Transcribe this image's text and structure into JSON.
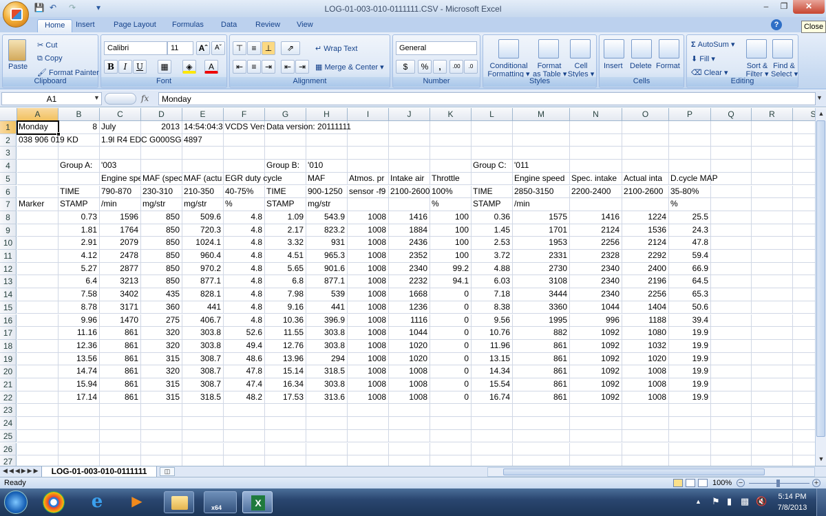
{
  "window": {
    "title": "LOG-01-003-010-0111111.CSV - Microsoft Excel",
    "close_tooltip": "Close"
  },
  "tabs": [
    "Home",
    "Insert",
    "Page Layout",
    "Formulas",
    "Data",
    "Review",
    "View"
  ],
  "ribbon": {
    "clipboard": {
      "label": "Clipboard",
      "paste": "Paste",
      "cut": "Cut",
      "copy": "Copy",
      "format_painter": "Format Painter"
    },
    "font": {
      "label": "Font",
      "name": "Calibri",
      "size": "11"
    },
    "alignment": {
      "label": "Alignment",
      "wrap": "Wrap Text",
      "merge": "Merge & Center"
    },
    "number": {
      "label": "Number",
      "format": "General"
    },
    "styles": {
      "label": "Styles",
      "cond1": "Conditional",
      "cond2": "Formatting",
      "fmt1": "Format",
      "fmt2": "as Table",
      "cell1": "Cell",
      "cell2": "Styles"
    },
    "cells": {
      "label": "Cells",
      "insert": "Insert",
      "delete": "Delete",
      "format": "Format"
    },
    "editing": {
      "label": "Editing",
      "autosum": "AutoSum",
      "fill": "Fill",
      "clear": "Clear",
      "sort1": "Sort &",
      "sort2": "Filter",
      "find1": "Find &",
      "find2": "Select"
    }
  },
  "formula_bar": {
    "name_box": "A1",
    "fx": "fx",
    "value": "Monday"
  },
  "columns": [
    "A",
    "B",
    "C",
    "D",
    "E",
    "F",
    "G",
    "H",
    "I",
    "J",
    "K",
    "L",
    "M",
    "N",
    "O",
    "P",
    "Q",
    "R",
    "S"
  ],
  "rows": [
    [
      "Monday",
      "8",
      "July",
      "2013",
      "14:54:04:3",
      "VCDS Vers",
      "Data version: 20111111",
      "",
      "",
      "",
      "",
      "",
      "",
      "",
      "",
      "",
      "",
      "",
      ""
    ],
    [
      "038 906 019 KD",
      "",
      "1.9l R4 EDC G000SG  4897",
      "",
      "",
      "",
      "",
      "",
      "",
      "",
      "",
      "",
      "",
      "",
      "",
      "",
      "",
      "",
      ""
    ],
    [
      "",
      "",
      "",
      "",
      "",
      "",
      "",
      "",
      "",
      "",
      "",
      "",
      "",
      "",
      "",
      "",
      "",
      "",
      ""
    ],
    [
      "",
      "Group A:",
      "'003",
      "",
      "",
      "",
      "Group B:",
      "'010",
      "",
      "",
      "",
      "Group C:",
      "'011",
      "",
      "",
      "",
      "",
      "",
      ""
    ],
    [
      "",
      "",
      "Engine spe",
      "MAF (spec",
      "MAF (actu",
      "EGR duty cycle",
      "",
      "MAF",
      "Atmos. pr",
      "Intake air",
      "Throttle",
      "",
      "Engine speed",
      "Spec. intake",
      "Actual inta",
      "D.cycle MAP",
      "",
      "",
      ""
    ],
    [
      "",
      "TIME",
      "790-870",
      "230-310",
      "210-350",
      "40-75%",
      "TIME",
      "900-1250",
      "sensor -f9",
      "2100-2600",
      "100%",
      "TIME",
      "2850-3150",
      "2200-2400",
      "2100-2600",
      "35-80%",
      "",
      "",
      ""
    ],
    [
      "Marker",
      "STAMP",
      "/min",
      "mg/str",
      "mg/str",
      "%",
      "STAMP",
      "mg/str",
      "",
      "",
      "%",
      "STAMP",
      "/min",
      "",
      "",
      "%",
      "",
      "",
      ""
    ],
    [
      "",
      "0.73",
      "1596",
      "850",
      "509.6",
      "4.8",
      "1.09",
      "543.9",
      "1008",
      "1416",
      "100",
      "0.36",
      "1575",
      "1416",
      "1224",
      "25.5",
      "",
      "",
      ""
    ],
    [
      "",
      "1.81",
      "1764",
      "850",
      "720.3",
      "4.8",
      "2.17",
      "823.2",
      "1008",
      "1884",
      "100",
      "1.45",
      "1701",
      "2124",
      "1536",
      "24.3",
      "",
      "",
      ""
    ],
    [
      "",
      "2.91",
      "2079",
      "850",
      "1024.1",
      "4.8",
      "3.32",
      "931",
      "1008",
      "2436",
      "100",
      "2.53",
      "1953",
      "2256",
      "2124",
      "47.8",
      "",
      "",
      ""
    ],
    [
      "",
      "4.12",
      "2478",
      "850",
      "960.4",
      "4.8",
      "4.51",
      "965.3",
      "1008",
      "2352",
      "100",
      "3.72",
      "2331",
      "2328",
      "2292",
      "59.4",
      "",
      "",
      ""
    ],
    [
      "",
      "5.27",
      "2877",
      "850",
      "970.2",
      "4.8",
      "5.65",
      "901.6",
      "1008",
      "2340",
      "99.2",
      "4.88",
      "2730",
      "2340",
      "2400",
      "66.9",
      "",
      "",
      ""
    ],
    [
      "",
      "6.4",
      "3213",
      "850",
      "877.1",
      "4.8",
      "6.8",
      "877.1",
      "1008",
      "2232",
      "94.1",
      "6.03",
      "3108",
      "2340",
      "2196",
      "64.5",
      "",
      "",
      ""
    ],
    [
      "",
      "7.58",
      "3402",
      "435",
      "828.1",
      "4.8",
      "7.98",
      "539",
      "1008",
      "1668",
      "0",
      "7.18",
      "3444",
      "2340",
      "2256",
      "65.3",
      "",
      "",
      ""
    ],
    [
      "",
      "8.78",
      "3171",
      "360",
      "441",
      "4.8",
      "9.16",
      "441",
      "1008",
      "1236",
      "0",
      "8.38",
      "3360",
      "1044",
      "1404",
      "50.6",
      "",
      "",
      ""
    ],
    [
      "",
      "9.96",
      "1470",
      "275",
      "406.7",
      "4.8",
      "10.36",
      "396.9",
      "1008",
      "1116",
      "0",
      "9.56",
      "1995",
      "996",
      "1188",
      "39.4",
      "",
      "",
      ""
    ],
    [
      "",
      "11.16",
      "861",
      "320",
      "303.8",
      "52.6",
      "11.55",
      "303.8",
      "1008",
      "1044",
      "0",
      "10.76",
      "882",
      "1092",
      "1080",
      "19.9",
      "",
      "",
      ""
    ],
    [
      "",
      "12.36",
      "861",
      "320",
      "303.8",
      "49.4",
      "12.76",
      "303.8",
      "1008",
      "1020",
      "0",
      "11.96",
      "861",
      "1092",
      "1032",
      "19.9",
      "",
      "",
      ""
    ],
    [
      "",
      "13.56",
      "861",
      "315",
      "308.7",
      "48.6",
      "13.96",
      "294",
      "1008",
      "1020",
      "0",
      "13.15",
      "861",
      "1092",
      "1020",
      "19.9",
      "",
      "",
      ""
    ],
    [
      "",
      "14.74",
      "861",
      "320",
      "308.7",
      "47.8",
      "15.14",
      "318.5",
      "1008",
      "1008",
      "0",
      "14.34",
      "861",
      "1092",
      "1008",
      "19.9",
      "",
      "",
      ""
    ],
    [
      "",
      "15.94",
      "861",
      "315",
      "308.7",
      "47.4",
      "16.34",
      "303.8",
      "1008",
      "1008",
      "0",
      "15.54",
      "861",
      "1092",
      "1008",
      "19.9",
      "",
      "",
      ""
    ],
    [
      "",
      "17.14",
      "861",
      "315",
      "318.5",
      "48.2",
      "17.53",
      "313.6",
      "1008",
      "1008",
      "0",
      "16.74",
      "861",
      "1092",
      "1008",
      "19.9",
      "",
      "",
      ""
    ],
    [
      "",
      "",
      "",
      "",
      "",
      "",
      "",
      "",
      "",
      "",
      "",
      "",
      "",
      "",
      "",
      "",
      "",
      "",
      ""
    ],
    [
      "",
      "",
      "",
      "",
      "",
      "",
      "",
      "",
      "",
      "",
      "",
      "",
      "",
      "",
      "",
      "",
      "",
      "",
      ""
    ],
    [
      "",
      "",
      "",
      "",
      "",
      "",
      "",
      "",
      "",
      "",
      "",
      "",
      "",
      "",
      "",
      "",
      "",
      "",
      ""
    ],
    [
      "",
      "",
      "",
      "",
      "",
      "",
      "",
      "",
      "",
      "",
      "",
      "",
      "",
      "",
      "",
      "",
      "",
      "",
      ""
    ],
    [
      "",
      "",
      "",
      "",
      "",
      "",
      "",
      "",
      "",
      "",
      "",
      "",
      "",
      "",
      "",
      "",
      "",
      "",
      ""
    ]
  ],
  "sheet_tab": "LOG-01-003-010-0111111",
  "status": {
    "ready": "Ready",
    "zoom": "100%"
  },
  "taskbar": {
    "time": "5:14 PM",
    "date": "7/8/2013",
    "vcds_label": "x64"
  }
}
